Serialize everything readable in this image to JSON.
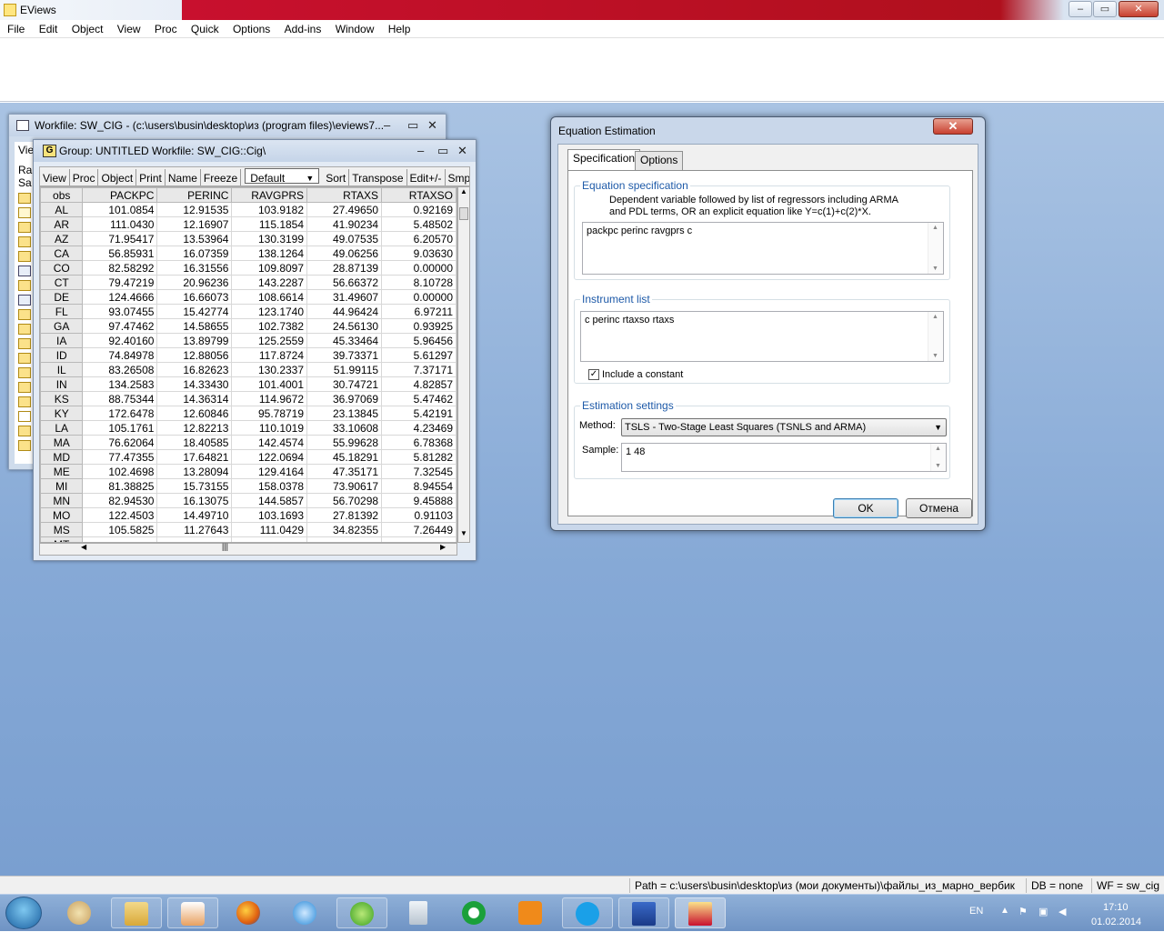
{
  "app": {
    "title": "EViews"
  },
  "menu": [
    "File",
    "Edit",
    "Object",
    "View",
    "Proc",
    "Quick",
    "Options",
    "Add-ins",
    "Window",
    "Help"
  ],
  "workfile": {
    "title": "Workfile: SW_CIG - (c:\\users\\busin\\desktop\\из (program files)\\eviews7...",
    "toolbar_partial": "Vie",
    "range_partial": "Ra",
    "sample_partial": "Sa"
  },
  "group": {
    "title": "Group: UNTITLED   Workfile: SW_CIG::Cig\\",
    "icon_letter": "G",
    "toolbar": [
      "View",
      "Proc",
      "Object",
      "Print",
      "Name",
      "Freeze",
      "Sort",
      "Transpose",
      "Edit+/-",
      "Smpl"
    ],
    "dropdown_value": "Default",
    "columns": [
      "obs",
      "PACKPC",
      "PERINC",
      "RAVGPRS",
      "RTAXS",
      "RTAXSO"
    ],
    "rows": [
      [
        "AL",
        "101.0854",
        "12.91535",
        "103.9182",
        "27.49650",
        "0.92169"
      ],
      [
        "AR",
        "111.0430",
        "12.16907",
        "115.1854",
        "41.90234",
        "5.48502"
      ],
      [
        "AZ",
        "71.95417",
        "13.53964",
        "130.3199",
        "49.07535",
        "6.20570"
      ],
      [
        "CA",
        "56.85931",
        "16.07359",
        "138.1264",
        "49.06256",
        "9.03630"
      ],
      [
        "CO",
        "82.58292",
        "16.31556",
        "109.8097",
        "28.87139",
        "0.00000"
      ],
      [
        "CT",
        "79.47219",
        "20.96236",
        "143.2287",
        "56.66372",
        "8.10728"
      ],
      [
        "DE",
        "124.4666",
        "16.66073",
        "108.6614",
        "31.49607",
        "0.00000"
      ],
      [
        "FL",
        "93.07455",
        "15.42774",
        "123.1740",
        "44.96424",
        "6.97211"
      ],
      [
        "GA",
        "97.47462",
        "14.58655",
        "102.7382",
        "24.56130",
        "0.93925"
      ],
      [
        "IA",
        "92.40160",
        "13.89799",
        "125.2559",
        "45.33464",
        "5.96456"
      ],
      [
        "ID",
        "74.84978",
        "12.88056",
        "117.8724",
        "39.73371",
        "5.61297"
      ],
      [
        "IL",
        "83.26508",
        "16.82623",
        "130.2337",
        "51.99115",
        "7.37171"
      ],
      [
        "IN",
        "134.2583",
        "14.33430",
        "101.4001",
        "30.74721",
        "4.82857"
      ],
      [
        "KS",
        "88.75344",
        "14.36314",
        "114.9672",
        "36.97069",
        "5.47462"
      ],
      [
        "KY",
        "172.6478",
        "12.60846",
        "95.78719",
        "23.13845",
        "5.42191"
      ],
      [
        "LA",
        "105.1761",
        "12.82213",
        "110.1019",
        "33.10608",
        "4.23469"
      ],
      [
        "MA",
        "76.62064",
        "18.40585",
        "142.4574",
        "55.99628",
        "6.78368"
      ],
      [
        "MD",
        "77.47355",
        "17.64821",
        "122.0694",
        "45.18291",
        "5.81282"
      ],
      [
        "ME",
        "102.4698",
        "13.28094",
        "129.4164",
        "47.35171",
        "7.32545"
      ],
      [
        "MI",
        "81.38825",
        "15.73155",
        "158.0378",
        "73.90617",
        "8.94554"
      ],
      [
        "MN",
        "82.94530",
        "16.13075",
        "144.5857",
        "56.70298",
        "9.45888"
      ],
      [
        "MO",
        "122.4503",
        "14.49710",
        "103.1693",
        "27.81392",
        "0.91103"
      ],
      [
        "MS",
        "105.5825",
        "11.27643",
        "111.0429",
        "34.82355",
        "7.26449"
      ],
      [
        "MT",
        "",
        "",
        "",
        "",
        ""
      ]
    ]
  },
  "dialog": {
    "title": "Equation Estimation",
    "tabs": [
      "Specification",
      "Options"
    ],
    "eq_spec": {
      "legend": "Equation specification",
      "help_line1": "Dependent variable followed by list of regressors including ARMA",
      "help_line2": "and PDL terms, OR an explicit equation like Y=c(1)+c(2)*X.",
      "value": "packpc perinc ravgprs  c"
    },
    "instruments": {
      "legend": "Instrument list",
      "value": "c perinc rtaxso rtaxs",
      "include_constant": "Include a constant"
    },
    "settings": {
      "legend": "Estimation settings",
      "method_label": "Method:",
      "method_value": "TSLS  - Two-Stage Least Squares (TSNLS and ARMA)",
      "sample_label": "Sample:",
      "sample_value": "1 48"
    },
    "ok": "OK",
    "cancel": "Отмена"
  },
  "status": {
    "path": "Path = c:\\users\\busin\\desktop\\из (мои документы)\\файлы_из_марно_вербик",
    "db": "DB = none",
    "wf": "WF = sw_cig"
  },
  "tray": {
    "lang": "EN",
    "time": "17:10",
    "date": "01.02.2014"
  },
  "colors": {
    "desktop": "#86a9d6",
    "accent": "#1e5aa8"
  }
}
